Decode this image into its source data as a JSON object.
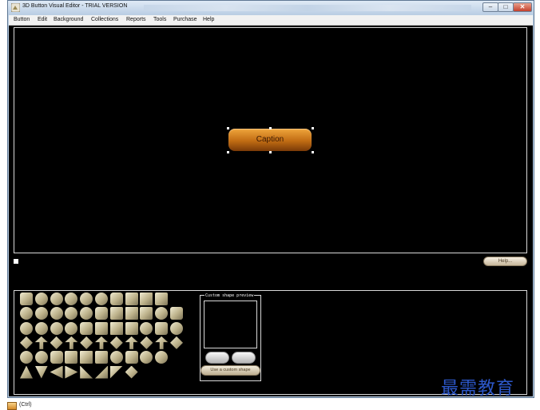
{
  "window": {
    "title": "3D Button Visual Editor - TRIAL VERSION",
    "controls": {
      "minimize": "–",
      "maximize": "□",
      "close": "✕"
    }
  },
  "menu": [
    "Button",
    "Edit",
    "Background",
    "Collections",
    "Reports",
    "Tools",
    "Purchase",
    "Help"
  ],
  "canvas": {
    "button_caption": "Caption",
    "accent_color": "#d27c1e"
  },
  "footer": {
    "help_button": "Help..."
  },
  "shapes_panel": {
    "icons": [
      "rounded-rect",
      "rounded-square",
      "circle",
      "circle-outline",
      "ellipse",
      "capsule",
      "rounded-square",
      "octagon",
      "square",
      "parallelogram",
      "oval",
      "circle",
      "rounded-rect",
      "rounded-rect",
      "oval-down",
      "oval",
      "rounded-rect",
      "square",
      "beveled-square",
      "square",
      "bevel",
      "square",
      "square",
      "square",
      "gear",
      "clover",
      "diamond-cut",
      "double-arrow",
      "tee",
      "square-bevel",
      "square",
      "arrow-up",
      "arrow-down",
      "arrow-left",
      "arrow-right",
      "arrow-up-right",
      "arrow-down-left",
      "arrow-diag",
      "arrow-diag",
      "arrow-up-left",
      "rounded-square",
      "trapezoid",
      "drop",
      "circle",
      "blob",
      "blob",
      "blob",
      "blob",
      "blob",
      "blob",
      "square",
      "rhombus",
      "triangle-up",
      "triangle-down",
      "triangle-left",
      "triangle-right",
      "right-triangle",
      "right-triangle",
      "wedge",
      "wedge"
    ],
    "custom_preview_label": "Custom shape preview",
    "use_custom_shape_button": "Use a custom shape"
  },
  "taskbar": {
    "label": "(Ctrl)"
  },
  "watermark": "最需教育"
}
